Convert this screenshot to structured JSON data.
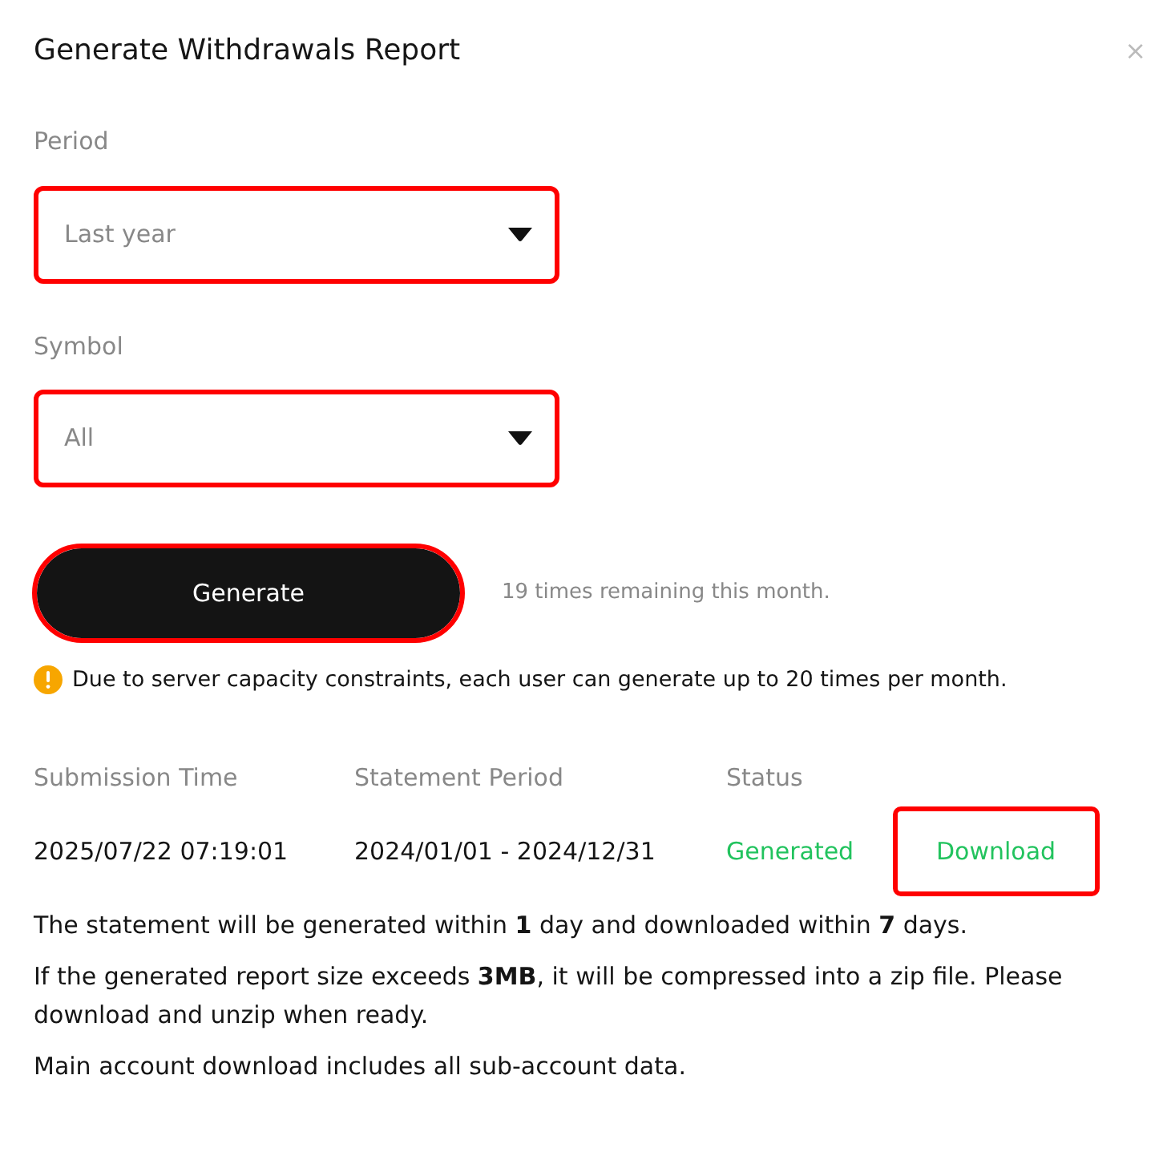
{
  "dialog": {
    "title": "Generate Withdrawals Report",
    "close": "×"
  },
  "fields": [
    {
      "label": "Period",
      "value": "Last year",
      "highlighted": true
    },
    {
      "label": "Symbol",
      "value": "All",
      "highlighted": true
    }
  ],
  "generate_button": {
    "label": "Generate",
    "highlighted": true
  },
  "remaining": "19 times remaining this month.",
  "warning": "Due to server capacity constraints, each user can generate up to 20 times per month.",
  "table": {
    "columns": [
      "Submission Time",
      "Statement Period",
      "Status"
    ],
    "rows": [
      {
        "submission_time": "2025/07/22 07:19:01",
        "statement_period": "2024/01/01 - 2024/12/31",
        "status": "Generated",
        "action": "Download",
        "action_highlighted": true
      }
    ]
  },
  "notes": [
    "The statement will be generated within **1** day and downloaded within **7** days.",
    "If the generated report size exceeds **3MB**, it will be compressed into a zip file. Please download and unzip when ready.",
    "Main account download includes all sub-account data."
  ]
}
